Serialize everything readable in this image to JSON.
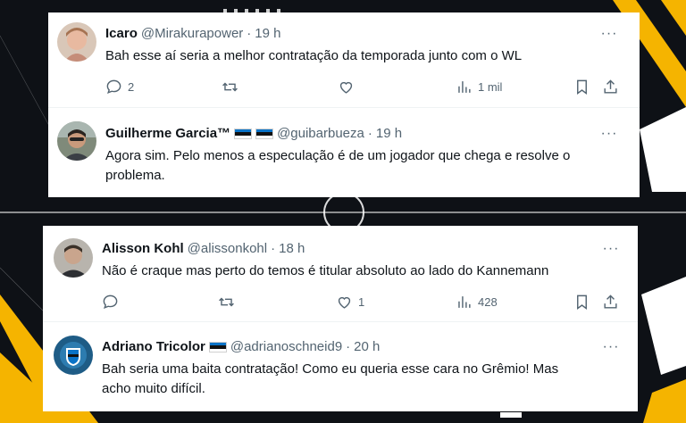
{
  "tweets": [
    {
      "name": "Icaro",
      "handle": "@Mirakurapower",
      "dot": "·",
      "time": "19 h",
      "text": "Bah esse aí seria a melhor contratação da temporada junto com o WL",
      "replies": "2",
      "retweets": "",
      "likes": "",
      "views": "1 mil",
      "more": "···"
    },
    {
      "name": "Guilherme Garcia™",
      "handle": "@guibarbueza",
      "dot": "·",
      "time": "19 h",
      "text_line1": "Agora sim. Pelo menos a especulação é de um jogador que chega e resolve o",
      "text_line2": "problema.",
      "more": "···"
    },
    {
      "name": "Alisson Kohl",
      "handle": "@alissonkohl",
      "dot": "·",
      "time": "18 h",
      "text": "Não é craque mas perto do temos é titular absoluto ao lado do Kannemann",
      "replies": "",
      "retweets": "",
      "likes": "1",
      "views": "428",
      "more": "···"
    },
    {
      "name": "Adriano Tricolor",
      "handle": "@adrianoschneid9",
      "dot": "·",
      "time": "20 h",
      "text_line1": "Bah seria uma baita contratação! Como eu queria esse cara no Grêmio! Mas",
      "text_line2": "acho muito difícil.",
      "more": "···"
    }
  ],
  "colors": {
    "text": "#0f1419",
    "muted": "#536471",
    "accent_yellow": "#f5b400",
    "background": "#0e1116",
    "flag_blue": "#0a73c7",
    "flag_black": "#111111"
  },
  "icons": [
    "reply-icon",
    "retweet-icon",
    "like-icon",
    "views-icon",
    "bookmark-icon",
    "share-icon",
    "more-icon"
  ]
}
